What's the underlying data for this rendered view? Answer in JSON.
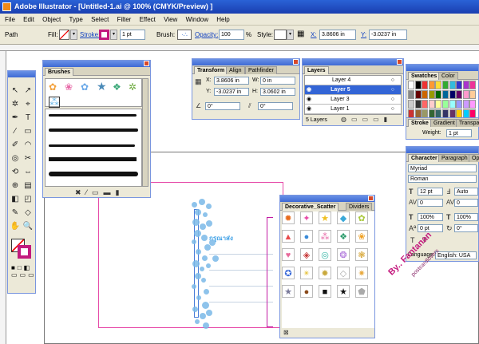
{
  "app_title": "Adobe Illustrator - [Untitled-1.ai @ 100% (CMYK/Preview) ]",
  "menu": [
    "File",
    "Edit",
    "Object",
    "Type",
    "Select",
    "Filter",
    "Effect",
    "View",
    "Window",
    "Help"
  ],
  "control": {
    "selection": "Path",
    "fill_label": "Fill:",
    "stroke_label": "Stroke:",
    "stroke_weight": "1 pt",
    "brush_label": "Brush:",
    "opacity_label": "Opacity:",
    "opacity_value": "100",
    "opacity_unit": "%",
    "style_label": "Style:",
    "x_label": "X:",
    "x_value": "3.8606 in",
    "y_label": "Y:",
    "y_value": "-3.0237 in"
  },
  "brushes_panel": {
    "tab": "Brushes"
  },
  "transform_panel": {
    "tabs": [
      "Transform",
      "Align",
      "Pathfinder"
    ],
    "x_label": "X:",
    "x": "3.8606 in",
    "y_label": "Y:",
    "y": "-3.0237 in",
    "w_label": "W:",
    "w": "0 in",
    "h_label": "H:",
    "h": "3.0602 in",
    "angle1": "0°",
    "angle2": "0°"
  },
  "layers_panel": {
    "tab": "Layers",
    "rows": [
      "Layer 4",
      "Layer 5",
      "Layer 3",
      "Layer 1"
    ],
    "selected": "Layer 5",
    "footer": "5 Layers"
  },
  "swatches_panel": {
    "tabs": [
      "Swatches",
      "Color"
    ]
  },
  "stroke_panel": {
    "tabs": [
      "Stroke",
      "Gradient",
      "Transpar"
    ],
    "weight_label": "Weight:",
    "weight": "1 pt"
  },
  "character_panel": {
    "tabs": [
      "Character",
      "Paragraph",
      "Ope"
    ],
    "font_family": "Myriad",
    "font_style": "Roman",
    "size": "12 pt",
    "leading": "Auto",
    "kerning": "0",
    "tracking": "0",
    "scale": "100%",
    "vscale": "100%",
    "baseline": "0 pt",
    "rotation": "0°",
    "language_label": "Language:",
    "language": "English: USA"
  },
  "scatter_panel": {
    "tabs": [
      "Decorative_Scatter",
      "Dividers"
    ]
  },
  "canvas": {
    "curve_text": "กรุณาส่ง"
  },
  "watermark": {
    "line1": "By.. Fantanan",
    "line2": "postcardlovers"
  },
  "colors": {
    "accent": "#3365d6",
    "pink": "#e64aa8",
    "magenta": "#c21aa3"
  }
}
